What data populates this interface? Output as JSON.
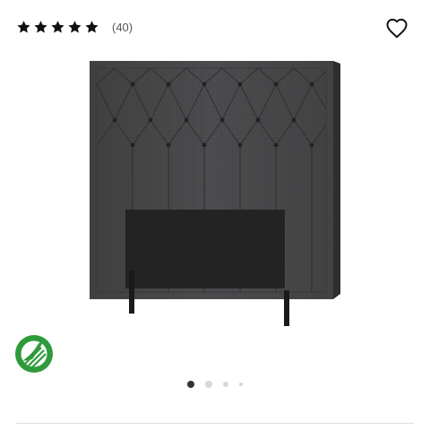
{
  "rating": {
    "stars": 5,
    "count_label": "(40)"
  },
  "icons": {
    "star": "star-icon",
    "favorite": "heart-outline-icon",
    "eco": "nordic-swan-ecolabel-icon"
  },
  "colors": {
    "star": "#111111",
    "headboard": "#4a4a4c",
    "eco_green": "#2e9b3b",
    "active_dot": "#333333",
    "inactive_dot": "#d7d7d7"
  },
  "carousel": {
    "total": 4,
    "active": 1
  }
}
